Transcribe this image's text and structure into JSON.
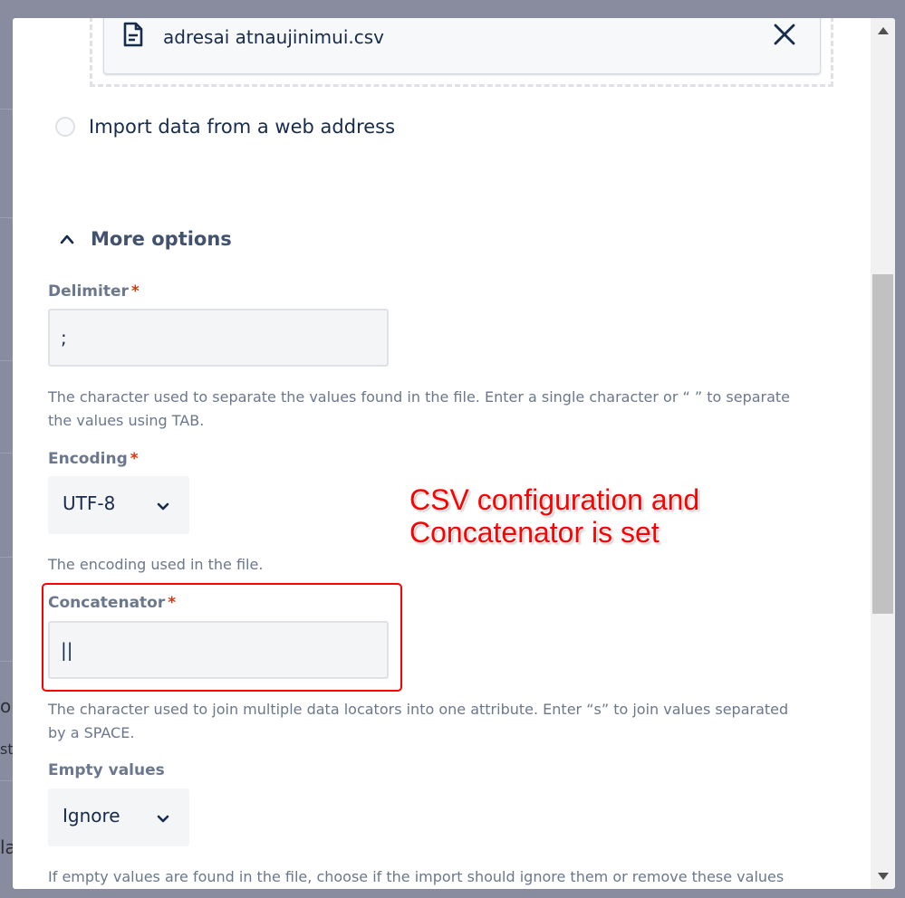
{
  "background": {
    "partial_texts": [
      "ou",
      "st",
      "la"
    ]
  },
  "file": {
    "name": "adresai atnaujinimui.csv"
  },
  "import_web": {
    "label": "Import data from a web address"
  },
  "more_options": {
    "label": "More options"
  },
  "delimiter": {
    "label": "Delimiter",
    "required_mark": "*",
    "value": ";",
    "helper": "The character used to separate the values found in the file. Enter a single character or “ ” to separate the values using TAB."
  },
  "encoding": {
    "label": "Encoding",
    "required_mark": "*",
    "value": "UTF-8",
    "helper": "The encoding used in the file."
  },
  "concatenator": {
    "label": "Concatenator",
    "required_mark": "*",
    "value": "||",
    "helper": "The character used to join multiple data locators into one attribute. Enter “s” to join values separated by a SPACE."
  },
  "empty_values": {
    "label": "Empty values",
    "value": "Ignore",
    "helper": "If empty values are found in the file, choose if the import should ignore them or remove these values from the"
  },
  "annotation": {
    "text": "CSV configuration and\nConcatenator is set"
  },
  "colors": {
    "annotation": "#ff0000",
    "required": "#de350b",
    "scroll_thumb": "#c1c1c1"
  }
}
